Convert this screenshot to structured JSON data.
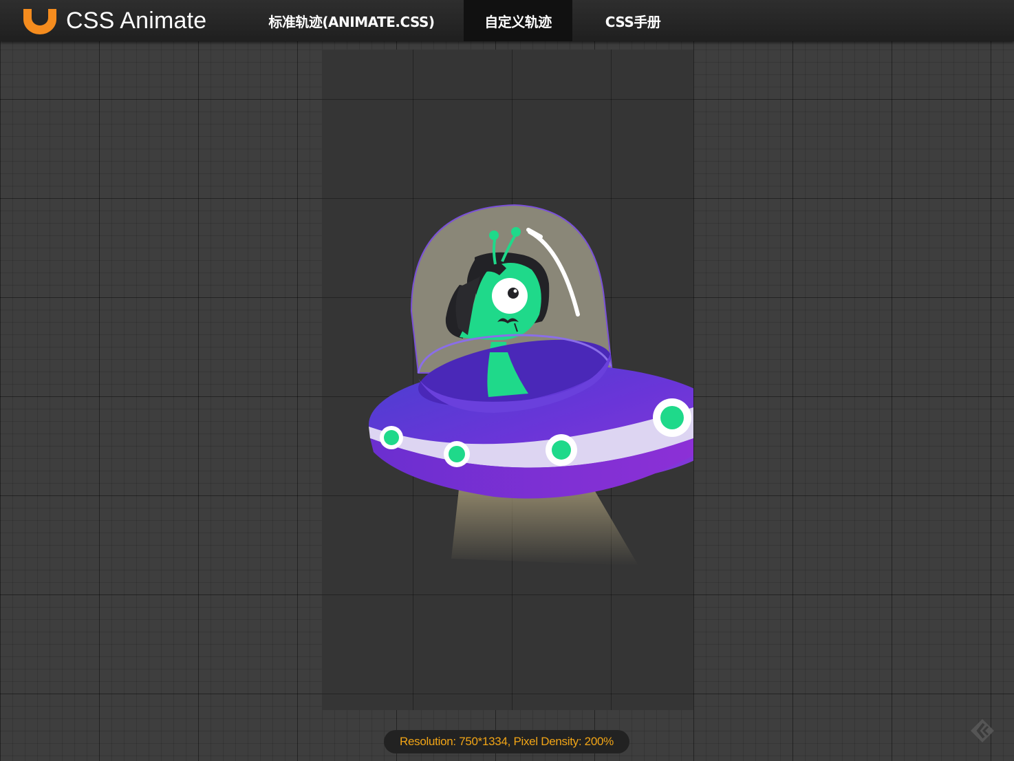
{
  "app": {
    "logo_text": "CSS Animate",
    "logo_color": "#f58c1e"
  },
  "nav": {
    "items": [
      {
        "label": "标准轨迹(ANIMATE.CSS)",
        "active": false
      },
      {
        "label": "自定义轨迹",
        "active": true
      },
      {
        "label": "CSS手册",
        "active": false
      }
    ]
  },
  "preview": {
    "illustration": "alien-ufo-illustration",
    "status": "Resolution: 750*1334, Pixel Density: 200%"
  },
  "colors": {
    "accent": "#f2a516",
    "ufo_purple": "#6b38d4",
    "alien_green": "#1fd98a",
    "background": "#3e3e3e"
  }
}
